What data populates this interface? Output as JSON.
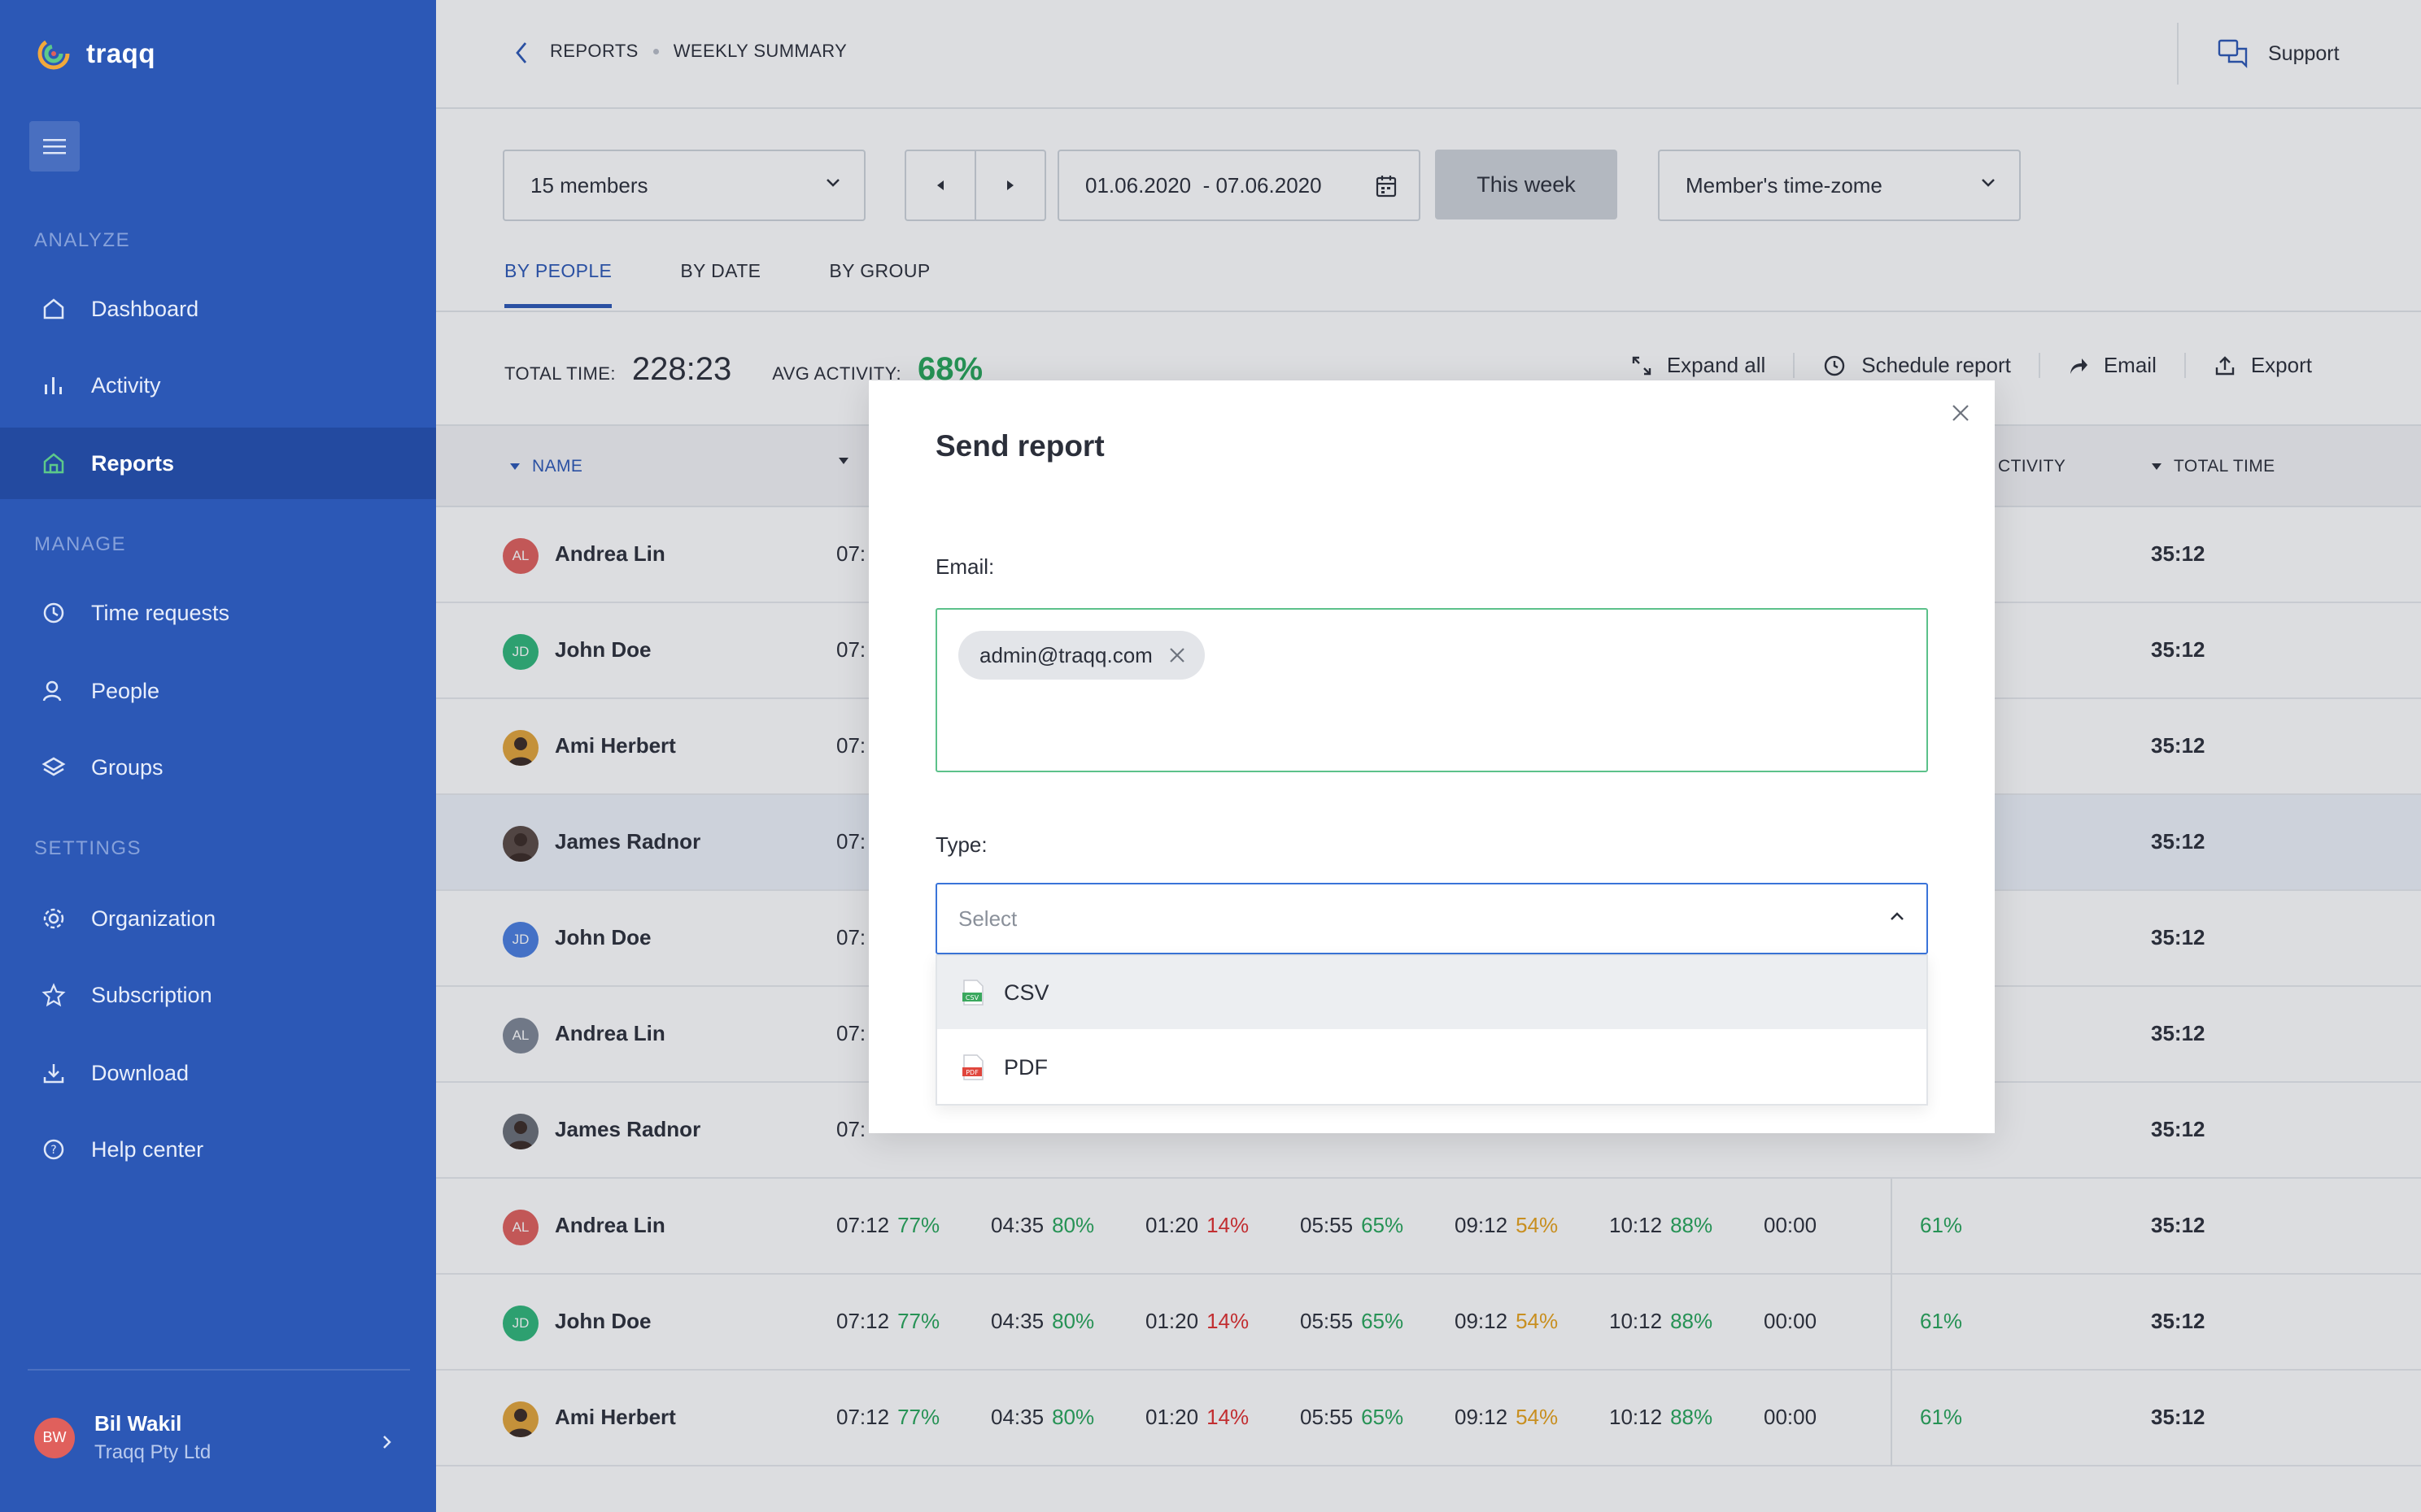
{
  "app": {
    "name": "traqq"
  },
  "sidebar": {
    "sections": {
      "analyze": "ANALYZE",
      "manage": "MANAGE",
      "settings": "SETTINGS"
    },
    "items": [
      {
        "label": "Dashboard",
        "icon": "home-icon"
      },
      {
        "label": "Activity",
        "icon": "bar-chart-icon"
      },
      {
        "label": "Reports",
        "icon": "reports-icon",
        "active": true
      },
      {
        "label": "Time requests",
        "icon": "clock-icon"
      },
      {
        "label": "People",
        "icon": "user-icon"
      },
      {
        "label": "Groups",
        "icon": "layers-icon"
      },
      {
        "label": "Organization",
        "icon": "gear-icon"
      },
      {
        "label": "Subscription",
        "icon": "star-icon"
      },
      {
        "label": "Download",
        "icon": "download-icon"
      },
      {
        "label": "Help center",
        "icon": "help-icon"
      }
    ],
    "user": {
      "initials": "BW",
      "name": "Bil Wakil",
      "org": "Traqq Pty Ltd"
    }
  },
  "header": {
    "breadcrumb": [
      "REPORTS",
      "WEEKLY SUMMARY"
    ],
    "support_label": "Support"
  },
  "filters": {
    "members": "15 members",
    "date_range": "01.06.2020  - 07.06.2020",
    "this_week": "This week",
    "timezone": "Member's time-zome"
  },
  "tabs": [
    "BY PEOPLE",
    "BY DATE",
    "BY GROUP"
  ],
  "summary": {
    "total_time_label": "TOTAL TIME:",
    "total_time": "228:23",
    "avg_activity_label": "AVG ACTIVITY:",
    "avg_activity": "68%"
  },
  "actions": {
    "expand_all": "Expand all",
    "schedule_report": "Schedule report",
    "email": "Email",
    "export": "Export"
  },
  "table": {
    "headers": {
      "name": "NAME",
      "activity": "CTIVITY",
      "total_time": "TOTAL TIME"
    },
    "rows": [
      {
        "initials": "AL",
        "avatar_color": "#e0605c",
        "name": "Andrea Lin",
        "first": "07:",
        "activity": "",
        "total": "35:12"
      },
      {
        "initials": "JD",
        "avatar_color": "#2fb77a",
        "name": "John Doe",
        "first": "07:",
        "activity": "",
        "total": "35:12"
      },
      {
        "initials": "",
        "avatar_color": "#e3a53a",
        "name": "Ami Herbert",
        "first": "07:",
        "activity": "",
        "total": "35:12"
      },
      {
        "initials": "",
        "avatar_color": "#5a4a44",
        "name": "James Radnor",
        "first": "07:",
        "activity": "",
        "total": "35:12",
        "highlight": true
      },
      {
        "initials": "JD",
        "avatar_color": "#4a7fe0",
        "name": "John Doe",
        "first": "07:",
        "activity": "",
        "total": "35:12"
      },
      {
        "initials": "AL",
        "avatar_color": "#7f8796",
        "name": "Andrea Lin",
        "first": "07:",
        "activity": "",
        "total": "35:12"
      },
      {
        "initials": "",
        "avatar_color": "#6a6f78",
        "name": "James Radnor",
        "first": "07:",
        "activity": "",
        "total": "35:12"
      },
      {
        "initials": "AL",
        "avatar_color": "#e0605c",
        "name": "Andrea Lin",
        "full": true,
        "activity": "61%",
        "total": "35:12"
      },
      {
        "initials": "JD",
        "avatar_color": "#2fb77a",
        "name": "John Doe",
        "full": true,
        "activity": "61%",
        "total": "35:12"
      },
      {
        "initials": "",
        "avatar_color": "#e3a53a",
        "name": "Ami Herbert",
        "full": true,
        "activity": "61%",
        "total": "35:12"
      }
    ],
    "full_row_days": [
      {
        "time": "07:12",
        "pct": "77%",
        "color": "g"
      },
      {
        "time": "04:35",
        "pct": "80%",
        "color": "g"
      },
      {
        "time": "01:20",
        "pct": "14%",
        "color": "r"
      },
      {
        "time": "05:55",
        "pct": "65%",
        "color": "g"
      },
      {
        "time": "09:12",
        "pct": "54%",
        "color": "o"
      },
      {
        "time": "10:12",
        "pct": "88%",
        "color": "g"
      },
      {
        "time": "00:00",
        "pct": "",
        "color": "m"
      }
    ]
  },
  "modal": {
    "title": "Send report",
    "email_label": "Email:",
    "email_chip": "admin@traqq.com",
    "type_label": "Type:",
    "type_placeholder": "Select",
    "options": [
      {
        "label": "CSV",
        "icon": "csv-file-icon",
        "icon_color": "#3aa85e"
      },
      {
        "label": "PDF",
        "icon": "pdf-file-icon",
        "icon_color": "#e0463d"
      }
    ]
  }
}
